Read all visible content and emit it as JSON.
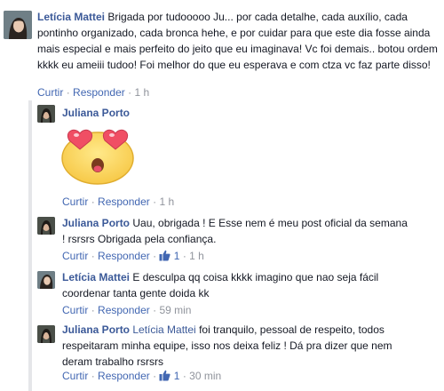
{
  "comments": [
    {
      "author": "Letícia Mattei",
      "text": "Brigada por tudooooo Ju... por cada detalhe, cada auxílio, cada pontinho organizado, cada bronca hehe, e por cuidar para que este dia fosse ainda mais especial e mais perfeito do jeito que eu imaginava! Vc foi demais.. botou ordem kkkk eu ameiii tudoo! Foi melhor do que eu esperava e com ctza vc faz parte disso!",
      "reply_label": "Curtir",
      "respond_label": "Responder",
      "time": "1 h"
    }
  ],
  "replies": [
    {
      "author": "Juliana Porto",
      "sticker": "heart-eyes-emoji",
      "reply_label": "Curtir",
      "respond_label": "Responder",
      "time": "1 h"
    },
    {
      "author": "Juliana Porto",
      "text": "Uau, obrigada ! E Esse nem é meu post oficial da semana ! rsrsrs Obrigada pela confiança.",
      "reply_label": "Curtir",
      "respond_label": "Responder",
      "likes": "1",
      "time": "1 h"
    },
    {
      "author": "Letícia Mattei",
      "text": "E desculpa qq coisa kkkk imagino que nao seja fácil coordenar tanta gente doida kk",
      "reply_label": "Curtir",
      "respond_label": "Responder",
      "time": "59 min"
    },
    {
      "author": "Juliana Porto",
      "mention": "Letícia Mattei",
      "text": "foi tranquilo, pessoal de respeito, todos respeitaram minha equipe, isso nos deixa feliz ! Dá pra dizer que nem deram trabalho rsrsrs",
      "reply_label": "Curtir",
      "respond_label": "Responder",
      "likes": "1",
      "time": "30 min"
    }
  ],
  "separator": "·",
  "colors": {
    "link": "#3b5998",
    "action": "#4267b2",
    "meta": "#90949c",
    "text": "#141823"
  }
}
